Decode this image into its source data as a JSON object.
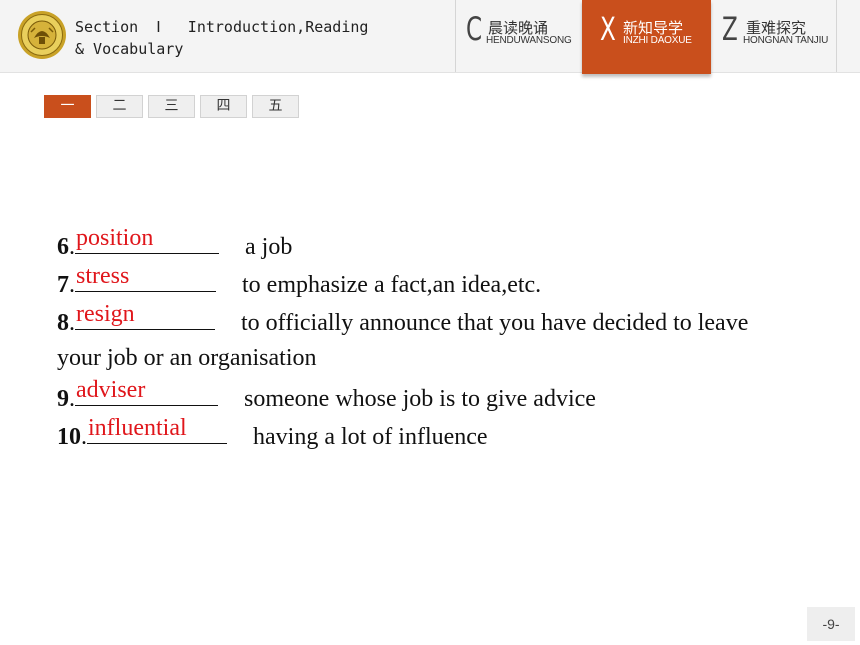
{
  "header": {
    "section_line1": "Section  Ⅰ   Introduction,Reading",
    "section_line2": "& Vocabulary",
    "nav": [
      {
        "letter": "C",
        "cn": "晨读晚诵",
        "pinyin": "HENDUWANSONG",
        "active": false
      },
      {
        "letter": "X",
        "cn": "新知导学",
        "pinyin": "INZHI DAOXUE",
        "active": true
      },
      {
        "letter": "Z",
        "cn": "重难探究",
        "pinyin": "HONGNAN TANJIU",
        "active": false
      }
    ],
    "accent_color": "#c94f1c"
  },
  "tabs": [
    {
      "label": "一",
      "active": true
    },
    {
      "label": "二",
      "active": false
    },
    {
      "label": "三",
      "active": false
    },
    {
      "label": "四",
      "active": false
    },
    {
      "label": "五",
      "active": false
    }
  ],
  "exercise": {
    "items": [
      {
        "number": "6",
        "answer": "position",
        "definition": "a job"
      },
      {
        "number": "7",
        "answer": "stress",
        "definition": "to emphasize a fact,an idea,etc."
      },
      {
        "number": "8",
        "answer": "resign",
        "definition": "to officially announce that you have decided to leave",
        "definition_cont": "your job or an organisation"
      },
      {
        "number": "9",
        "answer": "adviser",
        "definition": "someone whose job is to give advice"
      },
      {
        "number": "10",
        "answer": "influential",
        "definition": "having a lot of influence"
      }
    ],
    "answer_color": "#e0161b"
  },
  "footer": {
    "page_number": "-9-"
  }
}
